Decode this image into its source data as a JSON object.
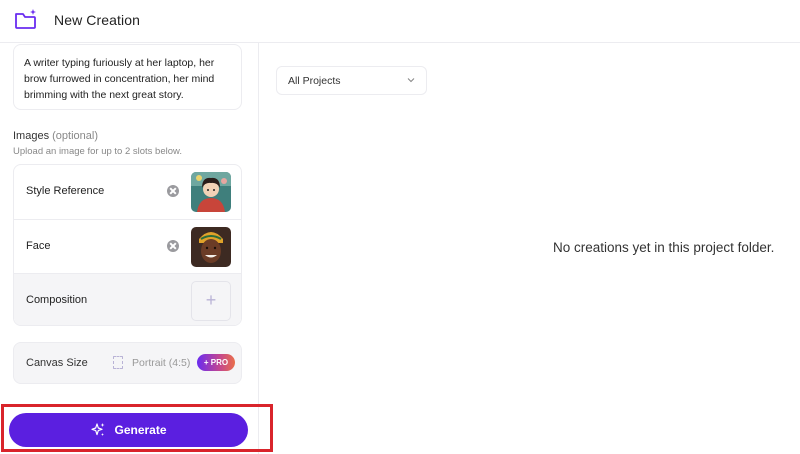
{
  "header": {
    "title": "New Creation",
    "icon": "folder-sparkle-icon"
  },
  "prompt": {
    "text": "A writer typing furiously at her laptop, her brow furrowed in concentration, her mind brimming with the next great story."
  },
  "images": {
    "label": "Images",
    "optional": "(optional)",
    "hint": "Upload an image for up to 2 slots below.",
    "slots": [
      {
        "label": "Style Reference",
        "has_image": true
      },
      {
        "label": "Face",
        "has_image": true
      },
      {
        "label": "Composition",
        "has_image": false,
        "add_symbol": "+"
      }
    ]
  },
  "canvas": {
    "label": "Canvas Size",
    "value": "Portrait (4:5)",
    "badge": "+ PRO"
  },
  "generate": {
    "label": "Generate"
  },
  "projects": {
    "selected": "All Projects"
  },
  "main": {
    "empty_message": "No creations yet in this project folder."
  },
  "colors": {
    "accent": "#5b1fe0",
    "highlight_border": "#d9242b",
    "divider": "#ececf0"
  }
}
